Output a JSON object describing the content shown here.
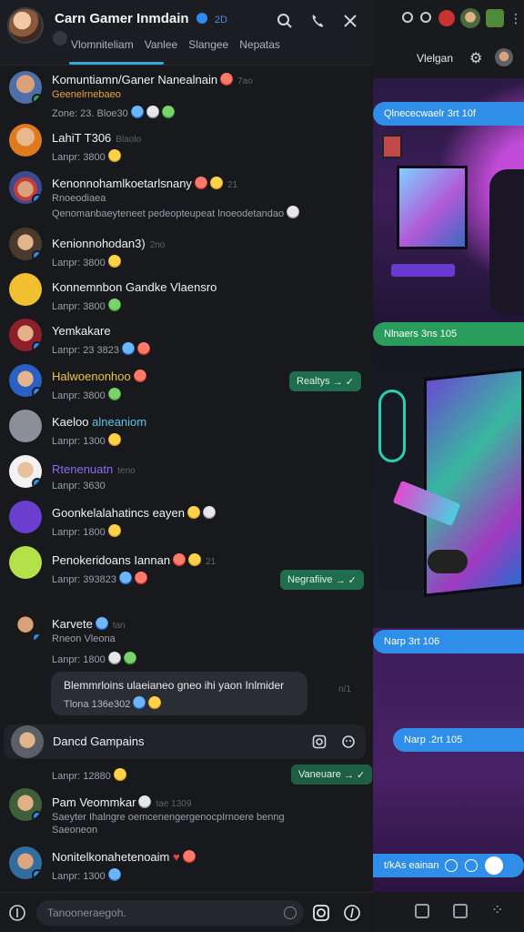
{
  "header": {
    "title": "Carn Gamer Inmdain",
    "count": "2D",
    "tabs": [
      "Vlomniteliam",
      "Vanlee",
      "Slangee",
      "Nepatas"
    ]
  },
  "chats": [
    {
      "name": "Komuntiamn/Ganer Nanealnain",
      "extra": "7ao",
      "sub": "Geenelrnebaeo",
      "sub2": "Zone: 23. Bloe30"
    },
    {
      "name": "LahiT T306",
      "extra": "Blaolo",
      "sub": "Lanpr: 3800"
    },
    {
      "name": "Kenonnohamlkoetarlsnany",
      "extra": "21",
      "sub": "Rnoeodiaea",
      "sub2": "Qenomanbaeyteneet pedeopteupeat lnoeodetandao"
    },
    {
      "name": "Kenionnohodan3)",
      "extra": "2no",
      "sub": "Lanpr: 3800"
    },
    {
      "name": "Konnemnbon Gandke Vlaensro",
      "sub": "Lanpr: 3800"
    },
    {
      "name": "Yemkakare",
      "sub": "Lanpr: 23 3823"
    },
    {
      "name": "Halwoenonhoo",
      "sub": "Lanpr: 3800"
    },
    {
      "name": "Kaeloo",
      "extra": "alneaniom",
      "sub": "Lanpr: 1300"
    },
    {
      "name": "Rtenenuatn",
      "extra": "teno",
      "sub": "Lanpr: 3630"
    },
    {
      "name": "Goonkelalahatincs eayen",
      "sub": "Lanpr: 1800"
    },
    {
      "name": "Penokeridoans Iannan",
      "extra": "21",
      "sub": "Lanpr: 393823"
    },
    {
      "name": "Karvete",
      "extra": "tan",
      "sub": "Rneon Vleona",
      "sub2": "Lanpr: 1800"
    },
    {
      "name": "Dancd Gampains",
      "sub": "Lanpr: 12880"
    },
    {
      "name": "Pam Veommkar",
      "extra": "tae 1309",
      "sub": "Saeyter Ihalngre oemcenengergenocpIrnoere benng",
      "sub2": "Saeoneon"
    },
    {
      "name": "Nonitelkonahetenoaim",
      "sub": "Lanpr: 1300"
    }
  ],
  "pills": {
    "p1": "Realtys",
    "p2": "Negrafiive",
    "p3": "Vaneuare"
  },
  "bubble": {
    "line1": "Blemmrloins ulaeianeo gneo ihi yaon Inlmider",
    "line2": "Tlona 136e302",
    "time": "n/1"
  },
  "composer": {
    "placeholder": "Tanooneraegoh."
  },
  "right": {
    "header_label": "Vlelgan",
    "msg1": "Qlnececwaelr 3rt 10f",
    "msg2": "Nlnaers 3ns 105",
    "msg3": "Narp 3rt 106",
    "msg4": "Narp .2rt 105",
    "msg5": "t/kAs eainan"
  }
}
